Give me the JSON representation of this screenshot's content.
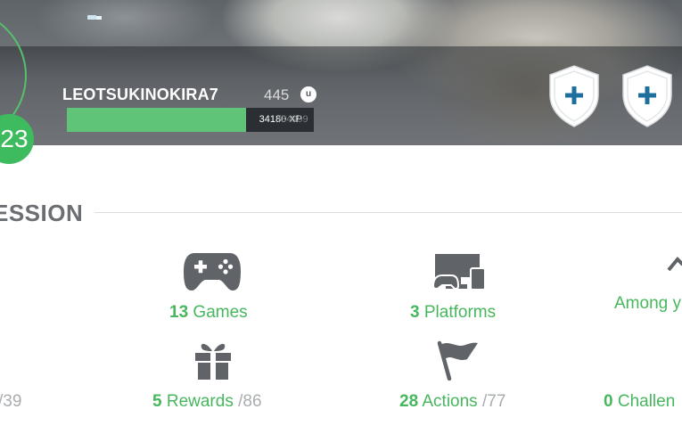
{
  "profile": {
    "level": "23",
    "username": "LEOTSUKINOKIRA7",
    "units": "445",
    "units_icon": "uplay-units-icon",
    "units_icon_glyph": "u",
    "xp": {
      "current_label": "34180 XP",
      "max_label": "/34999",
      "progress_fraction": 0.7247
    }
  },
  "shields": [
    {
      "icon": "add-shield-icon",
      "glyph": "+"
    },
    {
      "icon": "add-shield-icon",
      "glyph": "+"
    }
  ],
  "progression": {
    "title": "ESSION",
    "stats": {
      "games": {
        "num": "13",
        "label": "Games",
        "total": "",
        "icon": "gamepad-icon"
      },
      "platforms": {
        "num": "3",
        "label": "Platforms",
        "total": "",
        "icon": "platforms-icon"
      },
      "among": {
        "num": "",
        "label": "Among y",
        "total": "",
        "icon": "arrow-icon"
      },
      "rewards": {
        "num": "5",
        "label": "Rewards",
        "total": "/86",
        "icon": "gift-icon"
      },
      "actions": {
        "num": "28",
        "label": "Actions",
        "total": "/77",
        "icon": "flag-icon"
      },
      "challenges": {
        "num": "0",
        "label": "Challen",
        "total": "",
        "icon": "challenges-icon"
      },
      "left_partial": {
        "total": "/39"
      }
    }
  },
  "colors": {
    "accent_green": "#47b75e",
    "xp_fill": "#5fc477",
    "badge_green": "#3dbb5e",
    "icon_gray": "#606468",
    "shield_blue": "#1f6f9e"
  }
}
